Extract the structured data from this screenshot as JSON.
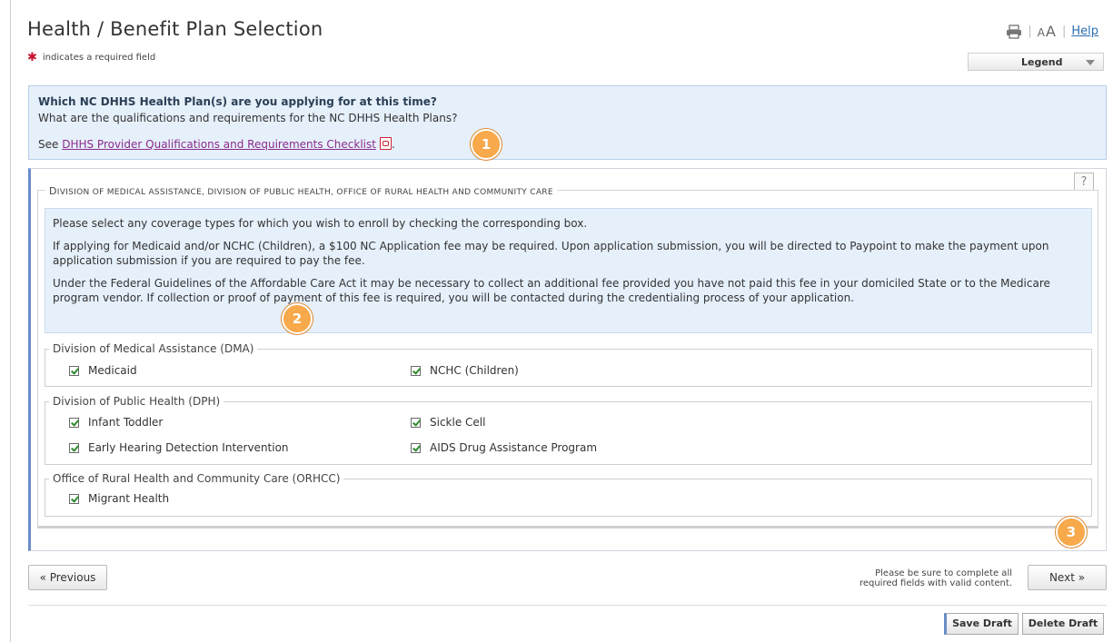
{
  "header": {
    "title": "Health / Benefit Plan Selection",
    "required_star": "✱",
    "required_note": "indicates a required field",
    "text_size_label_small": "A",
    "text_size_label_large": "A",
    "help_label": "Help",
    "legend_label": "Legend"
  },
  "question": {
    "heading": "Which NC DHHS Health Plan(s) are you applying for at this time?",
    "subheading": "What are the qualifications and requirements for the NC DHHS Health Plans?",
    "see_prefix": "See ",
    "checklist_link": "DHHS Provider Qualifications and Requirements Checklist",
    "see_suffix": "."
  },
  "section": {
    "legend": "Division of Medical Assistance, Division of Public Health, Office of Rural Health and Community Care",
    "help_icon": "?",
    "info": [
      "Please select any coverage types for which you wish to enroll by checking the corresponding box.",
      "If applying for Medicaid and/or NCHC (Children), a $100 NC Application fee may be required. Upon application submission, you will be directed to Paypoint to make the payment upon application submission if you are required to pay the fee.",
      "Under the Federal Guidelines of the Affordable Care Act it may be necessary to collect an additional fee provided you have not paid this fee in your domiciled State or to the Medicare program vendor. If collection or proof of payment of this fee is required, you will be contacted during the credentialing process of your application."
    ],
    "groups": [
      {
        "legend": "Division of Medical Assistance (DMA)",
        "options": [
          {
            "label": "Medicaid",
            "checked": true
          },
          {
            "label": "NCHC (Children)",
            "checked": true
          }
        ]
      },
      {
        "legend": "Division of Public Health (DPH)",
        "options": [
          {
            "label": "Infant Toddler",
            "checked": true
          },
          {
            "label": "Sickle Cell",
            "checked": true
          },
          {
            "label": "Early Hearing Detection Intervention",
            "checked": true
          },
          {
            "label": "AIDS Drug Assistance Program",
            "checked": true
          }
        ]
      },
      {
        "legend": "Office of Rural Health and Community Care (ORHCC)",
        "options": [
          {
            "label": "Migrant Health",
            "checked": true
          }
        ]
      }
    ]
  },
  "callouts": [
    "1",
    "2",
    "3"
  ],
  "footer": {
    "previous_label": "« Previous",
    "next_label": "Next »",
    "complete_note_line1": "Please be sure to complete all",
    "complete_note_line2": "required fields with valid content.",
    "save_draft_label": "Save Draft",
    "delete_draft_label": "Delete Draft"
  },
  "colors": {
    "panel_blue": "#e6f0fb",
    "accent_blue": "#6b8cc7",
    "required_red": "#c8102e",
    "callout_orange": "#f7a94b",
    "visited_link": "#8a2c8c"
  }
}
